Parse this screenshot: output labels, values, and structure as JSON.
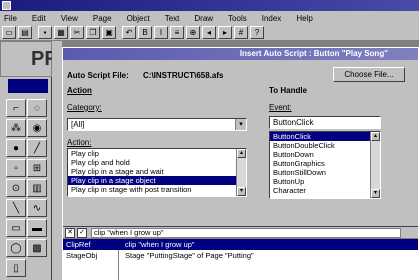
{
  "window": {
    "title": ""
  },
  "menu": [
    "File",
    "Edit",
    "View",
    "Page",
    "Object",
    "Text",
    "Draw",
    "Tools",
    "Index",
    "Help"
  ],
  "app_logo_text": "PF",
  "dialog": {
    "title": "Insert Auto Script : Button \"Play Song\"",
    "auto_script_file_label": "Auto Script File:",
    "auto_script_file_value": "C:\\INSTRUCT\\658.afs",
    "choose_file_label": "Choose File...",
    "action_label": "Action",
    "to_handle_label": "To Handle",
    "category_label": "Category:",
    "category_value": "[All]",
    "actions_label": "Action:",
    "actions": [
      "Play clip",
      "Play clip and hold",
      "Play clip in a stage and wait",
      "Play clip in a stage object",
      "Play clip in stage with post transition"
    ],
    "actions_selected_index": 3,
    "event_label": "Event:",
    "event_value": "ButtonClick",
    "events": [
      "ButtonClick",
      "ButtonDoubleClick",
      "ButtonDown",
      "ButtonGraphics",
      "ButtonStillDown",
      "ButtonUp",
      "Character"
    ],
    "events_selected_index": 0,
    "param_edit_value": "clip \"when I grow up\"",
    "params": [
      {
        "name": "ClipRef",
        "value": "clip \"when I grow up\""
      },
      {
        "name": "StageObj",
        "value": "Stage \"PuttingStage\" of Page \"Putting\""
      }
    ],
    "params_selected_index": 0
  }
}
